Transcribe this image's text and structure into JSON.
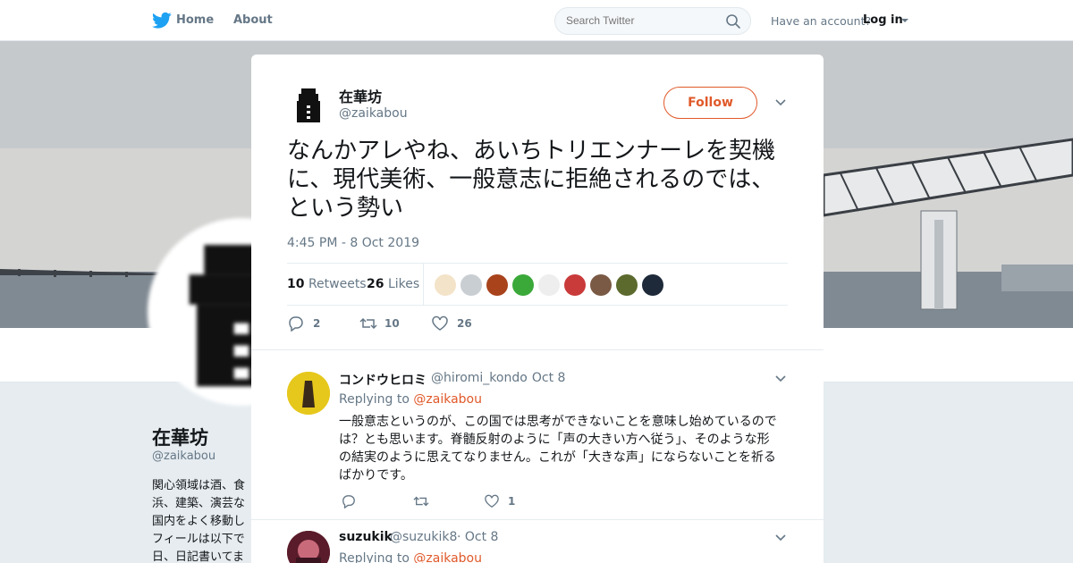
{
  "nav": {
    "home_label": "Home",
    "about_label": "About",
    "search_placeholder": "Search Twitter",
    "account_prompt": "Have an account?",
    "login_label": "Log in"
  },
  "background_profile": {
    "name": "在華坊",
    "handle": "@zaikabou",
    "bio": "関心領域は酒、食\n浜、建築、演芸な\n国内をよく移動し\nフィールは以下で\n日、日記書いてま"
  },
  "tweet": {
    "author_name": "在華坊",
    "author_handle": "@zaikabou",
    "follow_label": "Follow",
    "text": "なんかアレやね、あいちトリエンナーレを契機に、現代美術、一般意志に拒絶されるのでは、という勢い",
    "timestamp": "4:45 PM - 8 Oct 2019",
    "retweets_count": "10",
    "retweets_label": "Retweets",
    "likes_count": "26",
    "likes_label": "Likes",
    "actions": {
      "reply_count": "2",
      "retweet_count": "10",
      "like_count": "26"
    }
  },
  "replies": [
    {
      "name": "コンドウヒロミ",
      "handle": "@hiromi_kondo",
      "date": "· Oct 8",
      "replying_prefix": "Replying to",
      "replying_to": "@zaikabou",
      "text": "一般意志というのが、この国では思考ができないことを意味し始めているのでは？とも思います。脊髄反射のように「声の大きい方へ従う」、そのような形の結実のように思えてなりません。これが「大きな声」にならないことを祈るばかりです。",
      "like_count": "1"
    },
    {
      "name": "suzukik",
      "handle": "@suzukik8",
      "date": "· Oct 8",
      "replying_prefix": "Replying to",
      "replying_to": "@zaikabou"
    }
  ],
  "colors": {
    "accent": "#e0592a",
    "twitter_blue": "#1da1f2",
    "muted": "#657786"
  }
}
